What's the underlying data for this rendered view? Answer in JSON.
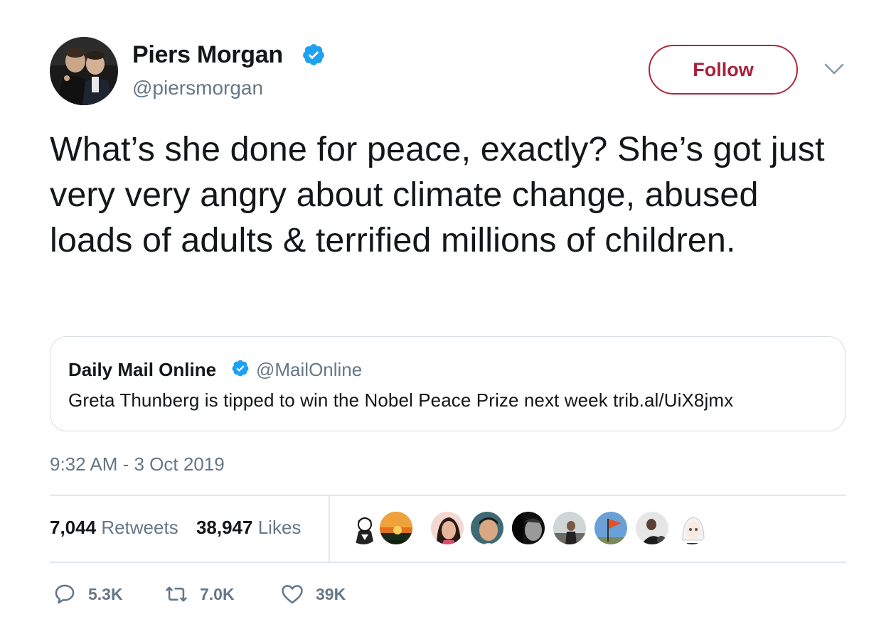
{
  "author": {
    "name": "Piers Morgan",
    "handle": "@piersmorgan",
    "verified": true,
    "avatar_icon": "profile-photo"
  },
  "follow_label": "Follow",
  "accent_color": "#a9203a",
  "verified_color": "#1da1f2",
  "tweet_text": "What’s she done for peace, exactly? She’s got just very very angry about climate change, abused loads of adults & terrified millions of children.",
  "quote": {
    "name": "Daily Mail Online",
    "handle": "@MailOnline",
    "verified": true,
    "text": "Greta Thunberg is tipped to win the Nobel Peace Prize next week trib.al/UiX8jmx"
  },
  "timestamp": "9:32 AM - 3 Oct 2019",
  "stats": {
    "retweets_count": "7,044",
    "retweets_label": "Retweets",
    "likes_count": "38,947",
    "likes_label": "Likes"
  },
  "liked_by_avatars": [
    "cartoon-avatar",
    "sunset-avatar",
    "woman-avatar",
    "man-avatar",
    "bw-portrait-avatar",
    "street-avatar",
    "flag-avatar",
    "man-dark-avatar",
    "anime-avatar"
  ],
  "actions": {
    "reply_count": "5.3K",
    "retweet_count": "7.0K",
    "like_count": "39K"
  }
}
